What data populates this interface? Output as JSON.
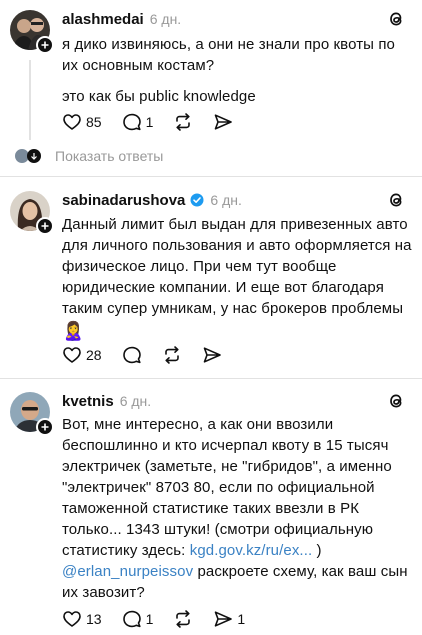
{
  "posts": [
    {
      "username": "alashmedai",
      "time": "6 дн.",
      "text1": "я дико извиняюсь, а они не знали про квоты по их основным костам?",
      "text2": "это как бы public knowledge",
      "likes": "85",
      "replies": "1"
    },
    {
      "username": "sabinadarushova",
      "time": "6 дн.",
      "text1": "Данный лимит был выдан для привезенных авто для личного пользования и авто оформляется на физическое лицо. При чем тут вообще юридические компании. И еще вот благодаря таким супер умникам, у нас брокеров проблемы",
      "emoji": "🙎‍♀️",
      "likes": "28"
    },
    {
      "username": "kvetnis",
      "time": "6 дн.",
      "text_part1": "Вот, мне интересно, а как они ввозили беспошлинно и кто исчерпал квоту в 15 тысяч электричек (заметьте, не \"гибридов\", а именно \"электричек\" 8703 80, если по официальной таможенной статистике таких ввезли в РК только... 1343 штуки! (смотри официальную статистику здесь: ",
      "link_url": "kgd.gov.kz/ru/ex...",
      "text_part2": " )",
      "mention": "@erlan_nurpeissov",
      "text_part3": " раскроете схему, как ваш сын их завозит?",
      "likes": "13",
      "replies": "1",
      "shares": "1"
    }
  ],
  "show_replies_label": "Показать ответы"
}
